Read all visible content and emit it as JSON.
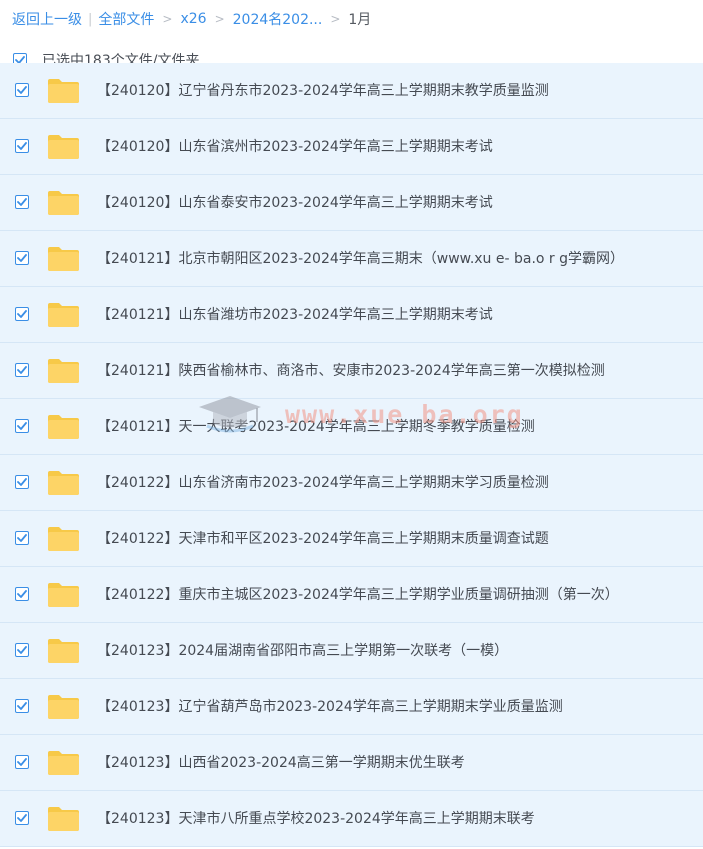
{
  "breadcrumb": {
    "back": "返回上一级",
    "separator": "|",
    "all_files": "全部文件",
    "chevron": ">",
    "path1": "x26",
    "path2": "2024名202...",
    "current": "1月"
  },
  "selection": {
    "label": "已选中183个文件/文件夹"
  },
  "files": [
    {
      "name": "【240120】辽宁省丹东市2023-2024学年高三上学期期末教学质量监测"
    },
    {
      "name": "【240120】山东省滨州市2023-2024学年高三上学期期末考试"
    },
    {
      "name": "【240120】山东省泰安市2023-2024学年高三上学期期末考试"
    },
    {
      "name": "【240121】北京市朝阳区2023-2024学年高三期末（www.xu e- ba.o r g学霸网）"
    },
    {
      "name": "【240121】山东省潍坊市2023-2024学年高三上学期期末考试"
    },
    {
      "name": "【240121】陕西省榆林市、商洛市、安康市2023-2024学年高三第一次模拟检测"
    },
    {
      "name": "【240121】天一大联考2023-2024学年高三上学期冬季教学质量检测"
    },
    {
      "name": "【240122】山东省济南市2023-2024学年高三上学期期末学习质量检测"
    },
    {
      "name": "【240122】天津市和平区2023-2024学年高三上学期期末质量调查试题"
    },
    {
      "name": "【240122】重庆市主城区2023-2024学年高三上学期学业质量调研抽测（第一次）"
    },
    {
      "name": "【240123】2024届湖南省邵阳市高三上学期第一次联考（一模）"
    },
    {
      "name": "【240123】辽宁省葫芦岛市2023-2024学年高三上学期期末学业质量监测"
    },
    {
      "name": "【240123】山西省2023-2024高三第一学期期末优生联考"
    },
    {
      "name": "【240123】天津市八所重点学校2023-2024学年高三上学期期末联考"
    }
  ],
  "watermark": {
    "text": "www.xue ba.org"
  },
  "colors": {
    "accent": "#3a8ee6",
    "row_bg": "#eaf4fd",
    "folder": "#fdd466"
  }
}
